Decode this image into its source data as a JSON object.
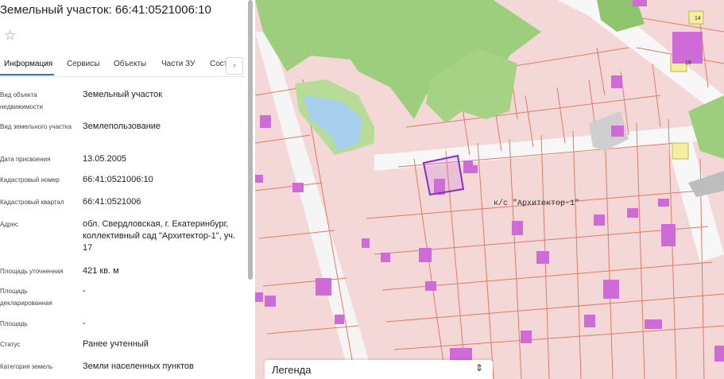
{
  "header": {
    "title": "Земельный участок: 66:41:0521006:10",
    "favorite_icon": "star-icon"
  },
  "tabs": {
    "items": [
      {
        "label": "Информация",
        "active": true
      },
      {
        "label": "Сервисы"
      },
      {
        "label": "Объекты"
      },
      {
        "label": "Части ЗУ"
      },
      {
        "label": "Сост"
      }
    ],
    "next_icon": "chevron-right-icon",
    "accent": "#2d74c8"
  },
  "info": {
    "rows": [
      {
        "label": "Вид объекта недвижимости",
        "value": "Земельный участок"
      },
      {
        "label": "Вид земельного участка",
        "value": "Землепользование"
      },
      {
        "label": "Дата присвоения",
        "value": "13.05.2005"
      },
      {
        "label": "Кадастровый номер",
        "value": "66:41:0521006:10"
      },
      {
        "label": "Кадастровый квартал",
        "value": "66:41:0521006"
      },
      {
        "label": "Адрес",
        "value": "обл. Свердловская, г. Екатеринбург, коллективный сад \"Архитектор-1\", уч. 17"
      },
      {
        "label": "Площадь уточненная",
        "value": "421 кв. м"
      },
      {
        "label": "Площадь декларированная",
        "value": "-"
      },
      {
        "label": "Площадь",
        "value": "-"
      },
      {
        "label": "Статус",
        "value": "Ранее учтенный"
      },
      {
        "label": "Категория земель",
        "value": "Земли населенных пунктов"
      }
    ]
  },
  "map": {
    "area_label": "к/с \"Архитектор-1\"",
    "house_numbers": [
      "14",
      "16"
    ],
    "colors": {
      "parcel_fill": "#f4d8d8",
      "parcel_line": "#e27b62",
      "building": "#cf6bd6",
      "selected": "#8a2fc0",
      "forest": "#9dce7e",
      "water": "#a9cfef",
      "road": "#f4f4f4"
    }
  },
  "legend": {
    "title": "Легенда",
    "toggle_icon": "chevron-updown-icon"
  }
}
